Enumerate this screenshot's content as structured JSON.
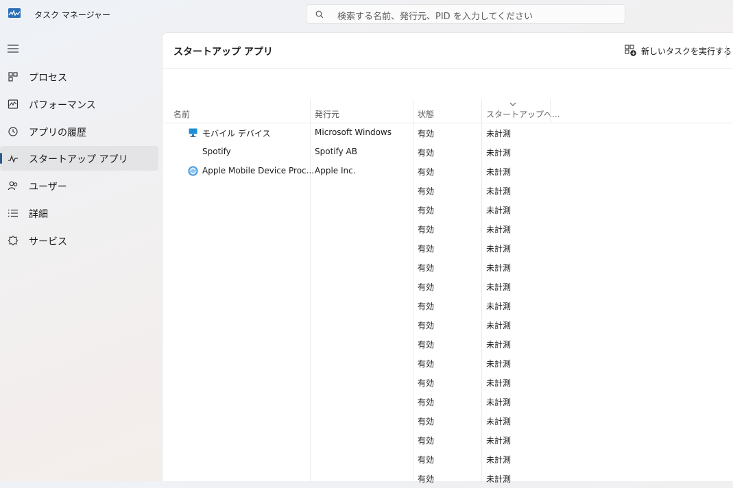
{
  "titlebar": {
    "app_title": "タスク マネージャー",
    "search_placeholder": "検索する名前、発行元、PID を入力してください"
  },
  "sidebar": {
    "items": [
      {
        "label": "プロセス",
        "icon": "processes-icon"
      },
      {
        "label": "パフォーマンス",
        "icon": "performance-icon"
      },
      {
        "label": "アプリの履歴",
        "icon": "app-history-icon"
      },
      {
        "label": "スタートアップ アプリ",
        "icon": "startup-icon",
        "active": true
      },
      {
        "label": "ユーザー",
        "icon": "users-icon"
      },
      {
        "label": "詳細",
        "icon": "details-icon"
      },
      {
        "label": "サービス",
        "icon": "services-icon"
      }
    ]
  },
  "main": {
    "title": "スタートアップ アプリ",
    "run_new_task": "新しいタスクを実行する",
    "columns": {
      "name": "名前",
      "publisher": "発行元",
      "status": "状態",
      "startup_impact": "スタートアップへ..."
    },
    "rows": [
      {
        "name": "モバイル デバイス",
        "publisher": "Microsoft Windows",
        "status": "有効",
        "impact": "未計測",
        "icon": "mobile-device-icon"
      },
      {
        "name": "Spotify",
        "publisher": "Spotify AB",
        "status": "有効",
        "impact": "未計測",
        "icon": ""
      },
      {
        "name": "Apple Mobile Device Proc...",
        "publisher": "Apple Inc.",
        "status": "有効",
        "impact": "未計測",
        "icon": "apple-sync-icon"
      },
      {
        "name": "",
        "publisher": "",
        "status": "有効",
        "impact": "未計測"
      },
      {
        "name": "",
        "publisher": "",
        "status": "有効",
        "impact": "未計測"
      },
      {
        "name": "",
        "publisher": "",
        "status": "有効",
        "impact": "未計測"
      },
      {
        "name": "",
        "publisher": "",
        "status": "有効",
        "impact": "未計測"
      },
      {
        "name": "",
        "publisher": "",
        "status": "有効",
        "impact": "未計測"
      },
      {
        "name": "",
        "publisher": "",
        "status": "有効",
        "impact": "未計測"
      },
      {
        "name": "",
        "publisher": "",
        "status": "有効",
        "impact": "未計測"
      },
      {
        "name": "",
        "publisher": "",
        "status": "有効",
        "impact": "未計測"
      },
      {
        "name": "",
        "publisher": "",
        "status": "有効",
        "impact": "未計測"
      },
      {
        "name": "",
        "publisher": "",
        "status": "有効",
        "impact": "未計測"
      },
      {
        "name": "",
        "publisher": "",
        "status": "有効",
        "impact": "未計測"
      },
      {
        "name": "",
        "publisher": "",
        "status": "有効",
        "impact": "未計測"
      },
      {
        "name": "",
        "publisher": "",
        "status": "有効",
        "impact": "未計測"
      },
      {
        "name": "",
        "publisher": "",
        "status": "有効",
        "impact": "未計測"
      },
      {
        "name": "",
        "publisher": "",
        "status": "有効",
        "impact": "未計測"
      },
      {
        "name": "",
        "publisher": "",
        "status": "有効",
        "impact": "未計測"
      }
    ]
  }
}
